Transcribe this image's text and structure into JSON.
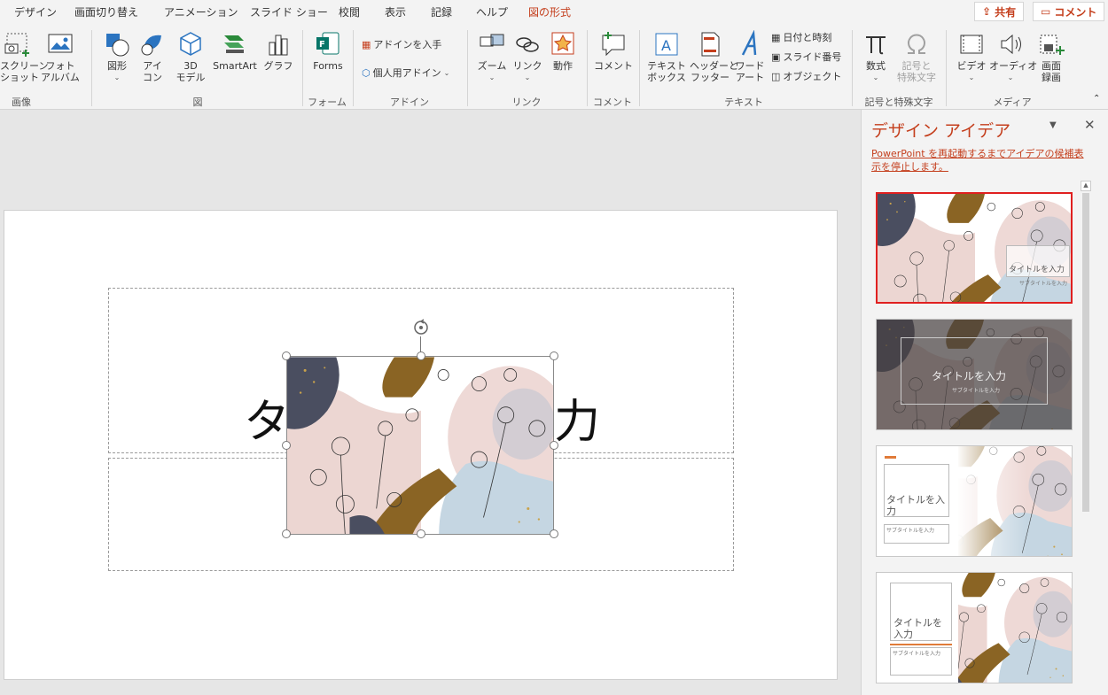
{
  "tabs": {
    "design": "デザイン",
    "transitions": "画面切り替え",
    "animations": "アニメーション",
    "slideshow": "スライド ショー",
    "review": "校閲",
    "view": "表示",
    "record": "記録",
    "help": "ヘルプ",
    "picture_format": "図の形式"
  },
  "topbar": {
    "share": "共有",
    "comment": "コメント"
  },
  "ribbon": {
    "screenshot_l1": "スクリーン",
    "screenshot_l2": "ショット",
    "album_l1": "フォト",
    "album_l2": "アルバム",
    "shapes": "図形",
    "icons_l1": "アイ",
    "icons_l2": "コン",
    "model_l1": "3D",
    "model_l2": "モデル",
    "smartart": "SmartArt",
    "chart": "グラフ",
    "forms": "Forms",
    "get_addins": "アドインを入手",
    "my_addins": "個人用アドイン",
    "zoom": "ズーム",
    "link": "リンク",
    "action": "動作",
    "comment": "コメント",
    "textbox_l1": "テキスト",
    "textbox_l2": "ボックス",
    "header_l1": "ヘッダーと",
    "header_l2": "フッター",
    "wordart_l1": "ワード",
    "wordart_l2": "アート",
    "datetime": "日付と時刻",
    "slide_number": "スライド番号",
    "object": "オブジェクト",
    "equation": "数式",
    "symbol_l1": "記号と",
    "symbol_l2": "特殊文字",
    "video": "ビデオ",
    "audio": "オーディオ",
    "screen_rec_l1": "画面",
    "screen_rec_l2": "録画",
    "groups": {
      "images": "画像",
      "illustrations": "図",
      "forms": "フォーム",
      "addins": "アドイン",
      "links": "リンク",
      "comments": "コメント",
      "text": "テキスト",
      "symbols": "記号と特殊文字",
      "media": "メディア"
    }
  },
  "slide": {
    "title_left": "タ",
    "title_right": "力"
  },
  "design_pane": {
    "title": "デザイン アイデア",
    "notice": "PowerPoint を再起動するまでアイデアの候補表示を停止します。",
    "ideas": [
      {
        "title": "タイトルを入力",
        "subtitle": "サブタイトルを入力"
      },
      {
        "title": "タイトルを入力",
        "subtitle": "サブタイトルを入力"
      },
      {
        "title_l1": "タイトルを入",
        "title_l2": "力",
        "subtitle": "サブタイトルを入力"
      },
      {
        "title_l1": "タイトルを",
        "title_l2": "入力",
        "subtitle": "サブタイトルを入力"
      }
    ]
  },
  "colors": {
    "accent": "#c43e1c",
    "selection": "#e02020"
  }
}
